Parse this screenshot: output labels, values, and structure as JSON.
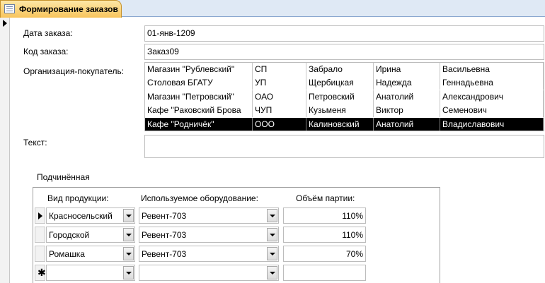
{
  "tab": {
    "title": "Формирование заказов",
    "icon": "form-icon"
  },
  "form": {
    "date_label": "Дата заказа:",
    "date_value": "01-янв-1209",
    "code_label": "Код заказа:",
    "code_value": "Заказ09",
    "org_label": "Организация-покупатель:",
    "text_label": "Текст:",
    "text_value": ""
  },
  "org_list": [
    [
      "Магазин \"Рублевский\"",
      "СП",
      "Забрало",
      "Ирина",
      "Васильевна"
    ],
    [
      "Столовая БГАТУ",
      "УП",
      "Щербицкая",
      "Надежда",
      "Геннадьевна"
    ],
    [
      "Магазин \"Петровский\"",
      "ОАО",
      "Петровский",
      "Анатолий",
      "Александрович"
    ],
    [
      "Кафе \"Раковский Брова",
      "ЧУП",
      "Кузьменя",
      "Виктор",
      "Семенович"
    ],
    [
      "Кафе \"Родничёк\"",
      "ООО",
      "Калиновский",
      "Анатолий",
      "Владиславович"
    ]
  ],
  "org_selected_index": 4,
  "subform": {
    "label": "Подчинённая",
    "headers": {
      "product": "Вид продукции:",
      "equipment": "Используемое оборудование:",
      "volume": "Объём партии:"
    },
    "rows": [
      {
        "product": "Красносельский",
        "equipment": "Ревент-703",
        "volume": "110%",
        "current": true
      },
      {
        "product": "Городской",
        "equipment": "Ревент-703",
        "volume": "110%",
        "current": false
      },
      {
        "product": "Ромашка",
        "equipment": "Ревент-703",
        "volume": "70%",
        "current": false
      },
      {
        "product": "",
        "equipment": "",
        "volume": "",
        "new": true
      }
    ]
  }
}
